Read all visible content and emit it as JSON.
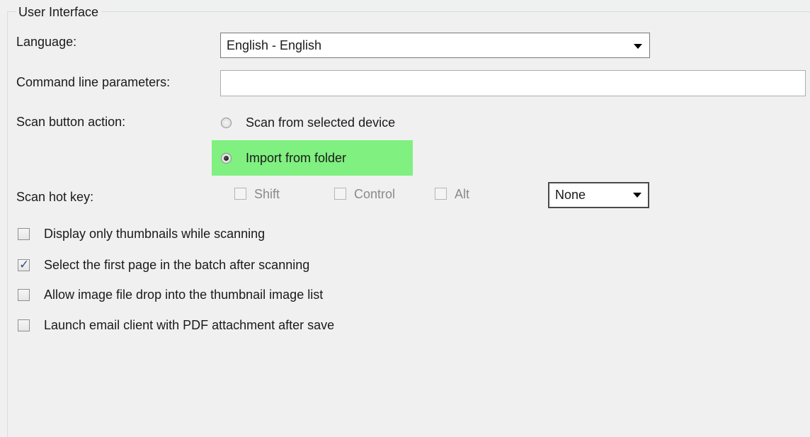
{
  "group": {
    "title": "User Interface"
  },
  "language": {
    "label": "Language:",
    "selected": "English - English"
  },
  "command_line": {
    "label": "Command line parameters:",
    "value": "",
    "placeholder": ""
  },
  "scan_button_action": {
    "label": "Scan button action:",
    "options": [
      {
        "label": "Scan from selected device",
        "selected": false
      },
      {
        "label": "Import from folder",
        "selected": true
      }
    ],
    "highlight_color": "#80f080"
  },
  "scan_hot_key": {
    "label": "Scan hot key:",
    "modifiers": [
      {
        "label": "Shift",
        "checked": false,
        "enabled": false
      },
      {
        "label": "Control",
        "checked": false,
        "enabled": false
      },
      {
        "label": "Alt",
        "checked": false,
        "enabled": false
      }
    ],
    "key_selected": "None"
  },
  "options": [
    {
      "label": "Display only thumbnails while scanning",
      "checked": false
    },
    {
      "label": "Select the first page in the batch after scanning",
      "checked": true
    },
    {
      "label": "Allow image file drop into the thumbnail image list",
      "checked": false
    },
    {
      "label": "Launch email client with PDF attachment after save",
      "checked": false
    }
  ],
  "icons": {
    "dropdown": "chevron-down-icon",
    "check": "check-icon"
  }
}
